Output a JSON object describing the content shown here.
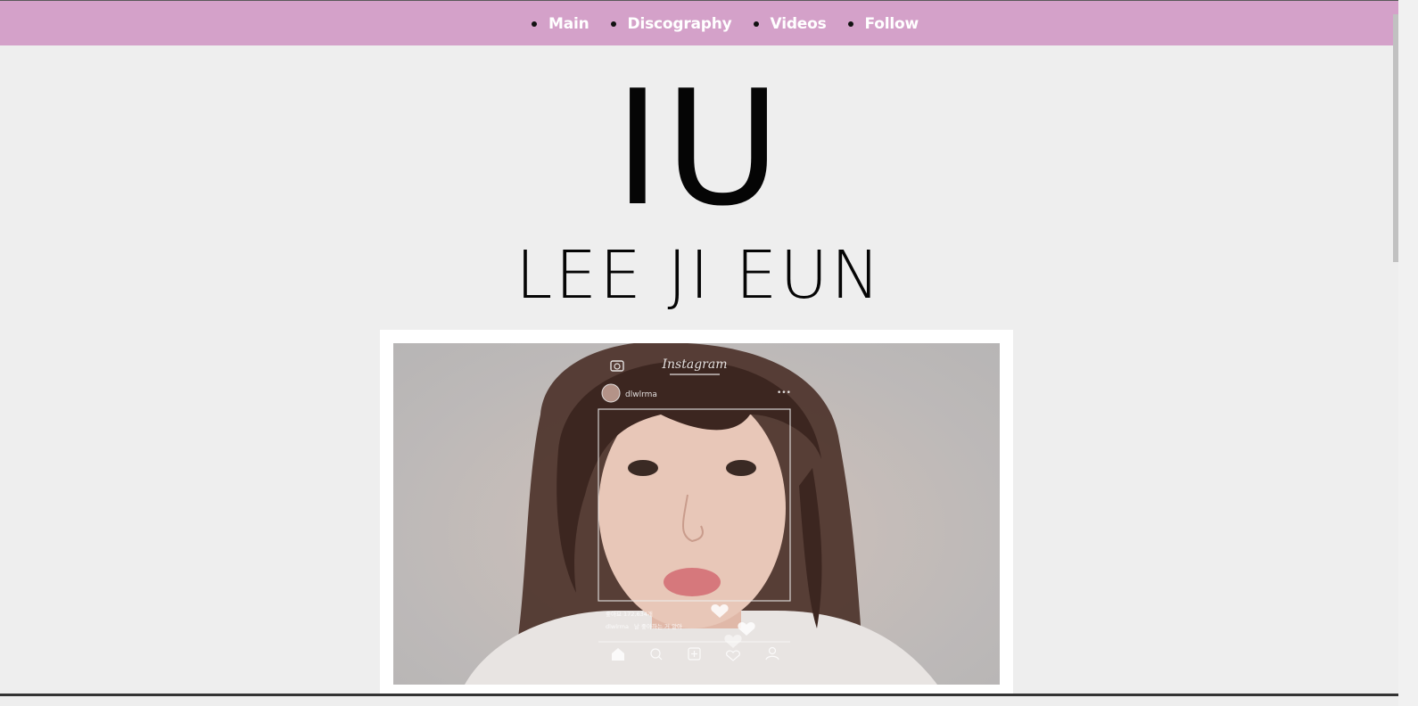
{
  "nav": {
    "items": [
      "Main",
      "Discography",
      "Videos",
      "Follow"
    ]
  },
  "header": {
    "title": "IU",
    "subtitle": "LEE JI EUN"
  },
  "photo": {
    "alt": "IU photo overlaid with Instagram UI",
    "overlay": {
      "app_title": "Instagram",
      "username": "dlwlrma",
      "likes": "좋아요 172,634개",
      "caption_user": "dlwlrma",
      "caption_text": "날 좋아하는 거 알아"
    }
  },
  "colors": {
    "topbar": "#d4a1c9",
    "background": "#eeeeee",
    "text": "#050505"
  }
}
